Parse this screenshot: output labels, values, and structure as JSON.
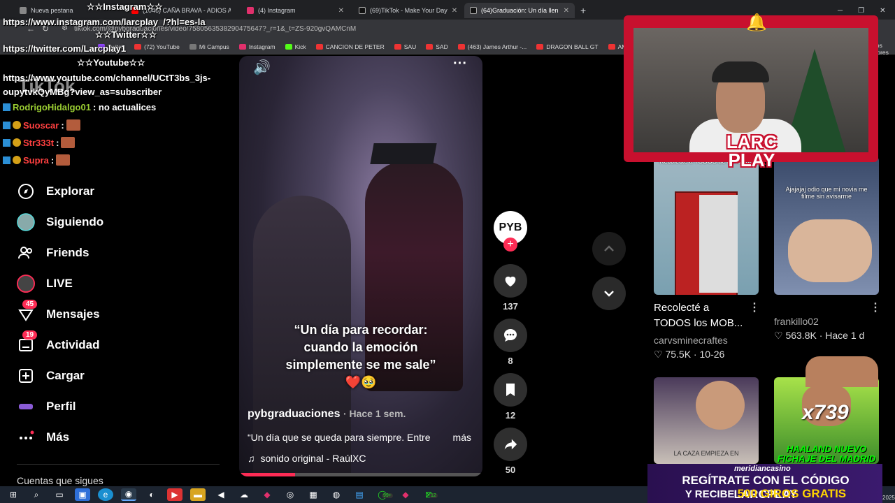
{
  "browser": {
    "tabs": [
      {
        "label": "Nueva pestana",
        "color": "#888888"
      },
      {
        "label": "(1046) CAÑA BRAVA - ADIOS A",
        "color": "#ff0000"
      },
      {
        "label": "(4) Instagram",
        "color": "#e1306c"
      },
      {
        "label": "(69)TikTok - Make Your Day",
        "color": "#111111"
      },
      {
        "label": "(64)Graduación: Un día llen",
        "color": "#111111"
      }
    ],
    "url": "tiktok.com/@pybgraduaciones/video/7580563538290475647?_r=1&_t=ZS-920gvQAMCnM",
    "bookmarks": [
      "Twitch",
      "(72) YouTube",
      "Mi Campus",
      "Instagram",
      "Kick",
      "CANCION DE PETER",
      "SAU",
      "SAD",
      "(463) James Arthur -...",
      "DRAGON BALL GT",
      "AMOR"
    ],
    "bookmarks_right": "Todos los marcadores"
  },
  "overlay": {
    "instagram_header": "☆☆Instagram☆☆",
    "instagram_url": "https://www.instagram.com/larcplay_/?hl=es-la",
    "twitter_header": "☆☆Twitter☆☆",
    "twitter_url": "https://twitter.com/Larcplay1",
    "youtube_header": "☆☆Youtube☆☆",
    "youtube_url": "https://www.youtube.com/channel/UCtT3bs_3js-oupytvkQyMBg?view_as=subscriber",
    "tiktok_logo": "TikTok",
    "chat": [
      {
        "user": "RodrigoHidalgo01",
        "message": ": no actualices",
        "color": "#9acd32"
      },
      {
        "user": "Suoscar",
        "message": ":",
        "color": "#ff4040"
      },
      {
        "user": "Str333t",
        "message": ":",
        "color": "#ff4040"
      },
      {
        "user": "Supra",
        "message": ":",
        "color": "#ff4040"
      }
    ]
  },
  "nav": {
    "items": [
      {
        "label": "Explorar"
      },
      {
        "label": "Siguiendo"
      },
      {
        "label": "Friends"
      },
      {
        "label": "LIVE"
      },
      {
        "label": "Mensajes",
        "badge": "45"
      },
      {
        "label": "Actividad",
        "badge": "19"
      },
      {
        "label": "Cargar"
      },
      {
        "label": "Perfil"
      },
      {
        "label": "Más"
      }
    ],
    "following_section": "Cuentas que sigues"
  },
  "video": {
    "caption_l1": "“Un día para recordar:",
    "caption_l2": "cuando la emoción",
    "caption_l3": "simplemente se me sale”",
    "caption_emoji": "❤️🥹",
    "author": "pybgraduaciones",
    "time": "· Hace 1 sem.",
    "description": "“Un día que se queda para siempre. Entre",
    "more": "más",
    "sound": "sonido original - RaúlXC",
    "avatar_text": "PYB",
    "progress_fraction": 0.23
  },
  "actions": {
    "likes": "137",
    "comments": "8",
    "saves": "12",
    "shares": "50"
  },
  "stream": {
    "brand_l1": "LARC",
    "brand_l2": "PLAY"
  },
  "recommendations": [
    {
      "title_l1": "Recolecté a",
      "title_l2": "TODOS los MOB...",
      "user": "carvsminecraftes",
      "likes": "75.5K",
      "date": "10-26",
      "thumb_text": "Recolecté a TODOS de Minecraft"
    },
    {
      "title_l1": "",
      "title_l2": "",
      "user": "frankillo02",
      "likes": "563.8K",
      "date": "Hace 1 d",
      "thumb_text": "Ajajajaj odio que mi novia me filme sin avisarme"
    },
    {
      "thumb_text": "LA CAZA EMPIEZA EN"
    },
    {
      "thumb_text": "HAALAND NUEVO FICHAJE DEL MADRID",
      "thumb_badge": "x739"
    }
  ],
  "banner": {
    "brand": "meridiancasino",
    "line1": "REGÍTRATE CON EL CÓDIGO  LARCPLAY",
    "line2_pre": "Y RECIBE ",
    "line2_highlight": "500 GIROS GRATIS"
  },
  "taskbar": {
    "tray_year": "2025",
    "badge_99": "99+",
    "badge_12": "12"
  }
}
